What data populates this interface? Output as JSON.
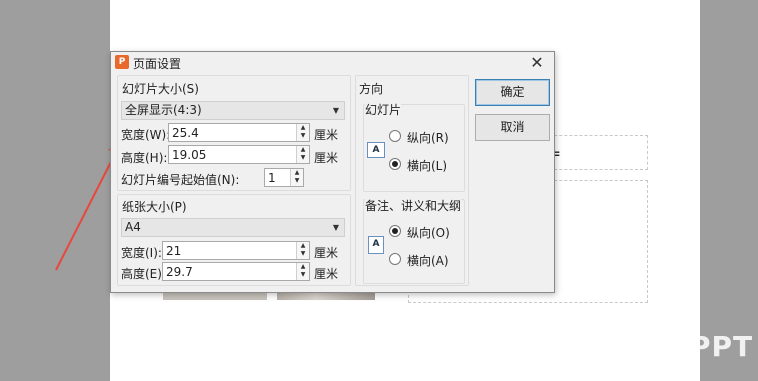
{
  "dialog": {
    "title": "页面设置",
    "app_icon_glyph": "P",
    "close_glyph": "✕"
  },
  "slide_size": {
    "group_title": "幻灯片大小(S)",
    "selected": "全屏显示(4:3)",
    "width_label": "宽度(W):",
    "width_value": "25.4",
    "height_label": "高度(H):",
    "height_value": "19.05",
    "unit": "厘米",
    "start_number_label": "幻灯片编号起始值(N):",
    "start_number_value": "1"
  },
  "paper_size": {
    "group_title": "纸张大小(P)",
    "selected": "A4",
    "width_label": "宽度(I):",
    "width_value": "21",
    "height_label": "高度(E):",
    "height_value": "29.7",
    "unit": "厘米"
  },
  "orientation": {
    "group_title": "方向",
    "slides": {
      "title": "幻灯片",
      "icon_glyph": "A",
      "portrait_label": "纵向(R)",
      "landscape_label": "横向(L)",
      "selected": "landscape"
    },
    "notes": {
      "title": "备注、讲义和大纲",
      "icon_glyph": "A",
      "portrait_label": "纵向(O)",
      "landscape_label": "横向(A)",
      "selected": "portrait"
    }
  },
  "buttons": {
    "ok": "确定",
    "cancel": "取消"
  },
  "background": {
    "watermark": "PPT",
    "placeholder_glyph": "="
  },
  "colors": {
    "annotation_arrow": "#e8473d",
    "app_icon": "#e9692c"
  }
}
